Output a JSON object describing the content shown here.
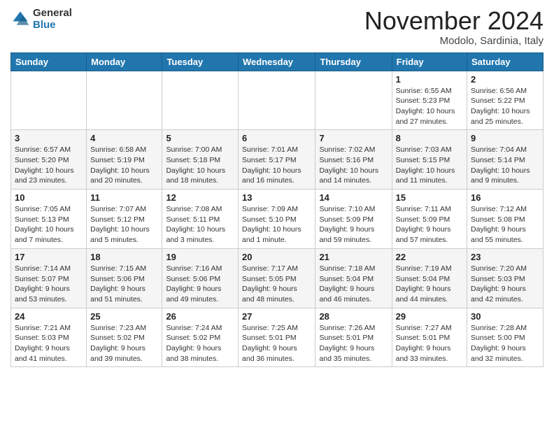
{
  "header": {
    "logo_line1": "General",
    "logo_line2": "Blue",
    "month_title": "November 2024",
    "location": "Modolo, Sardinia, Italy"
  },
  "days_of_week": [
    "Sunday",
    "Monday",
    "Tuesday",
    "Wednesday",
    "Thursday",
    "Friday",
    "Saturday"
  ],
  "weeks": [
    [
      {
        "day": "",
        "info": ""
      },
      {
        "day": "",
        "info": ""
      },
      {
        "day": "",
        "info": ""
      },
      {
        "day": "",
        "info": ""
      },
      {
        "day": "",
        "info": ""
      },
      {
        "day": "1",
        "info": "Sunrise: 6:55 AM\nSunset: 5:23 PM\nDaylight: 10 hours\nand 27 minutes."
      },
      {
        "day": "2",
        "info": "Sunrise: 6:56 AM\nSunset: 5:22 PM\nDaylight: 10 hours\nand 25 minutes."
      }
    ],
    [
      {
        "day": "3",
        "info": "Sunrise: 6:57 AM\nSunset: 5:20 PM\nDaylight: 10 hours\nand 23 minutes."
      },
      {
        "day": "4",
        "info": "Sunrise: 6:58 AM\nSunset: 5:19 PM\nDaylight: 10 hours\nand 20 minutes."
      },
      {
        "day": "5",
        "info": "Sunrise: 7:00 AM\nSunset: 5:18 PM\nDaylight: 10 hours\nand 18 minutes."
      },
      {
        "day": "6",
        "info": "Sunrise: 7:01 AM\nSunset: 5:17 PM\nDaylight: 10 hours\nand 16 minutes."
      },
      {
        "day": "7",
        "info": "Sunrise: 7:02 AM\nSunset: 5:16 PM\nDaylight: 10 hours\nand 14 minutes."
      },
      {
        "day": "8",
        "info": "Sunrise: 7:03 AM\nSunset: 5:15 PM\nDaylight: 10 hours\nand 11 minutes."
      },
      {
        "day": "9",
        "info": "Sunrise: 7:04 AM\nSunset: 5:14 PM\nDaylight: 10 hours\nand 9 minutes."
      }
    ],
    [
      {
        "day": "10",
        "info": "Sunrise: 7:05 AM\nSunset: 5:13 PM\nDaylight: 10 hours\nand 7 minutes."
      },
      {
        "day": "11",
        "info": "Sunrise: 7:07 AM\nSunset: 5:12 PM\nDaylight: 10 hours\nand 5 minutes."
      },
      {
        "day": "12",
        "info": "Sunrise: 7:08 AM\nSunset: 5:11 PM\nDaylight: 10 hours\nand 3 minutes."
      },
      {
        "day": "13",
        "info": "Sunrise: 7:09 AM\nSunset: 5:10 PM\nDaylight: 10 hours\nand 1 minute."
      },
      {
        "day": "14",
        "info": "Sunrise: 7:10 AM\nSunset: 5:09 PM\nDaylight: 9 hours\nand 59 minutes."
      },
      {
        "day": "15",
        "info": "Sunrise: 7:11 AM\nSunset: 5:09 PM\nDaylight: 9 hours\nand 57 minutes."
      },
      {
        "day": "16",
        "info": "Sunrise: 7:12 AM\nSunset: 5:08 PM\nDaylight: 9 hours\nand 55 minutes."
      }
    ],
    [
      {
        "day": "17",
        "info": "Sunrise: 7:14 AM\nSunset: 5:07 PM\nDaylight: 9 hours\nand 53 minutes."
      },
      {
        "day": "18",
        "info": "Sunrise: 7:15 AM\nSunset: 5:06 PM\nDaylight: 9 hours\nand 51 minutes."
      },
      {
        "day": "19",
        "info": "Sunrise: 7:16 AM\nSunset: 5:06 PM\nDaylight: 9 hours\nand 49 minutes."
      },
      {
        "day": "20",
        "info": "Sunrise: 7:17 AM\nSunset: 5:05 PM\nDaylight: 9 hours\nand 48 minutes."
      },
      {
        "day": "21",
        "info": "Sunrise: 7:18 AM\nSunset: 5:04 PM\nDaylight: 9 hours\nand 46 minutes."
      },
      {
        "day": "22",
        "info": "Sunrise: 7:19 AM\nSunset: 5:04 PM\nDaylight: 9 hours\nand 44 minutes."
      },
      {
        "day": "23",
        "info": "Sunrise: 7:20 AM\nSunset: 5:03 PM\nDaylight: 9 hours\nand 42 minutes."
      }
    ],
    [
      {
        "day": "24",
        "info": "Sunrise: 7:21 AM\nSunset: 5:03 PM\nDaylight: 9 hours\nand 41 minutes."
      },
      {
        "day": "25",
        "info": "Sunrise: 7:23 AM\nSunset: 5:02 PM\nDaylight: 9 hours\nand 39 minutes."
      },
      {
        "day": "26",
        "info": "Sunrise: 7:24 AM\nSunset: 5:02 PM\nDaylight: 9 hours\nand 38 minutes."
      },
      {
        "day": "27",
        "info": "Sunrise: 7:25 AM\nSunset: 5:01 PM\nDaylight: 9 hours\nand 36 minutes."
      },
      {
        "day": "28",
        "info": "Sunrise: 7:26 AM\nSunset: 5:01 PM\nDaylight: 9 hours\nand 35 minutes."
      },
      {
        "day": "29",
        "info": "Sunrise: 7:27 AM\nSunset: 5:01 PM\nDaylight: 9 hours\nand 33 minutes."
      },
      {
        "day": "30",
        "info": "Sunrise: 7:28 AM\nSunset: 5:00 PM\nDaylight: 9 hours\nand 32 minutes."
      }
    ]
  ]
}
